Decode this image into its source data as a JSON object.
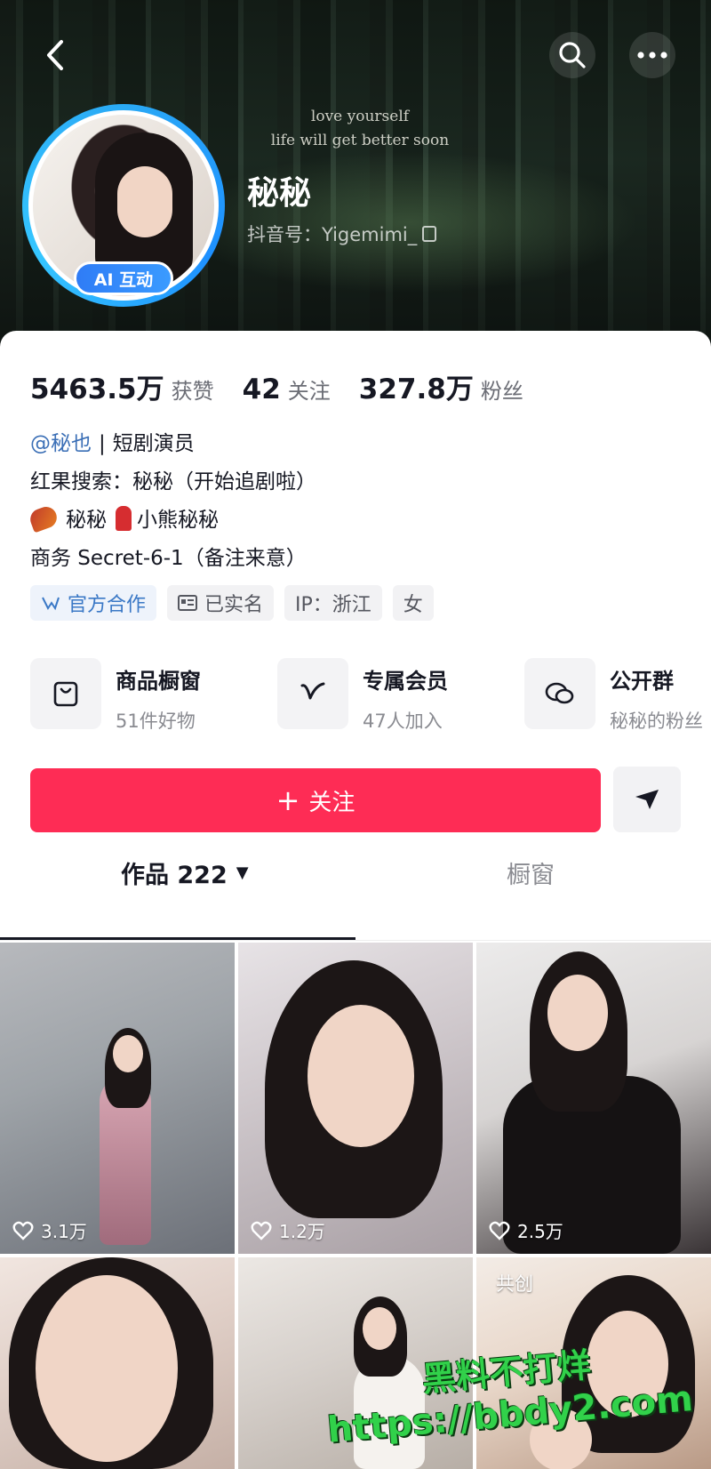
{
  "banner": {
    "quote_line1": "love yourself",
    "quote_line2": "life will get better soon"
  },
  "profile": {
    "nickname": "秘秘",
    "douyin_id": "抖音号：Yigemimi_",
    "ai_badge": "AI 互动"
  },
  "stats": [
    {
      "value": "5463.5万",
      "label": "获赞"
    },
    {
      "value": "42",
      "label": "关注"
    },
    {
      "value": "327.8万",
      "label": "粉丝"
    }
  ],
  "bio": {
    "mention": "@秘也",
    "role": "短剧演员",
    "line2": "红果搜索：秘秘（开始追剧啦）",
    "line3_a": "秘秘",
    "line3_b": "小熊秘秘",
    "line4": "商务 Secret-6-1（备注来意）"
  },
  "tags": [
    {
      "label": "官方合作"
    },
    {
      "label": "已实名"
    },
    {
      "label": "IP：浙江"
    },
    {
      "label": "女"
    }
  ],
  "features": [
    {
      "title": "商品橱窗",
      "subtitle": "51件好物",
      "icon": "bag-icon"
    },
    {
      "title": "专属会员",
      "subtitle": "47人加入",
      "icon": "v-icon"
    },
    {
      "title": "公开群",
      "subtitle": "秘秘的粉丝",
      "icon": "chat-icon"
    }
  ],
  "actions": {
    "follow_plus": "+",
    "follow_label": "关注"
  },
  "tabs": {
    "works_label": "作品 222",
    "shop_label": "橱窗"
  },
  "videos": [
    {
      "likes": "3.1万"
    },
    {
      "likes": "1.2万"
    },
    {
      "likes": "2.5万"
    },
    {
      "likes": ""
    },
    {
      "likes": ""
    },
    {
      "likes": "",
      "badge": "共创"
    }
  ],
  "watermark": {
    "line1": "黑料不打烊",
    "line2": "https://bbdy2.com"
  },
  "colors": {
    "follow_button": "#fe2c55",
    "mention": "#3b6fb6",
    "ai_badge": "#2f7cf6",
    "watermark": "#31d14a"
  }
}
